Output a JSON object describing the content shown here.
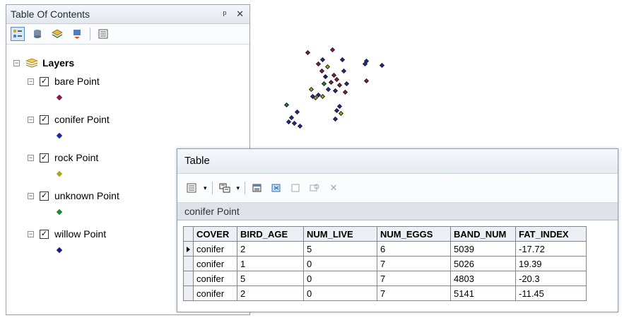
{
  "toc": {
    "title": "Table Of Contents",
    "pin_label": "ᵖ",
    "close_label": "✕",
    "group": {
      "name": "Layers",
      "expander": "⊟"
    },
    "layers": [
      {
        "name": "bare Point",
        "color": "#8b1a4f"
      },
      {
        "name": "conifer Point",
        "color": "#1c2aa8"
      },
      {
        "name": "rock Point",
        "color": "#a8a81c"
      },
      {
        "name": "unknown Point",
        "color": "#1a8c2a"
      },
      {
        "name": "willow Point",
        "color": "#1a1a8c"
      }
    ]
  },
  "table_window": {
    "title": "Table",
    "tab_label": "conifer Point",
    "columns": [
      "COVER",
      "BIRD_AGE",
      "NUM_LIVE",
      "NUM_EGGS",
      "BAND_NUM",
      "FAT_INDEX"
    ],
    "rows": [
      [
        "conifer",
        "2",
        "5",
        "6",
        "5039",
        "-17.72"
      ],
      [
        "conifer",
        "1",
        "0",
        "7",
        "5026",
        "19.39"
      ],
      [
        "conifer",
        "5",
        "0",
        "7",
        "4803",
        "-20.3"
      ],
      [
        "conifer",
        "2",
        "0",
        "7",
        "5141",
        "-11.45"
      ]
    ]
  }
}
